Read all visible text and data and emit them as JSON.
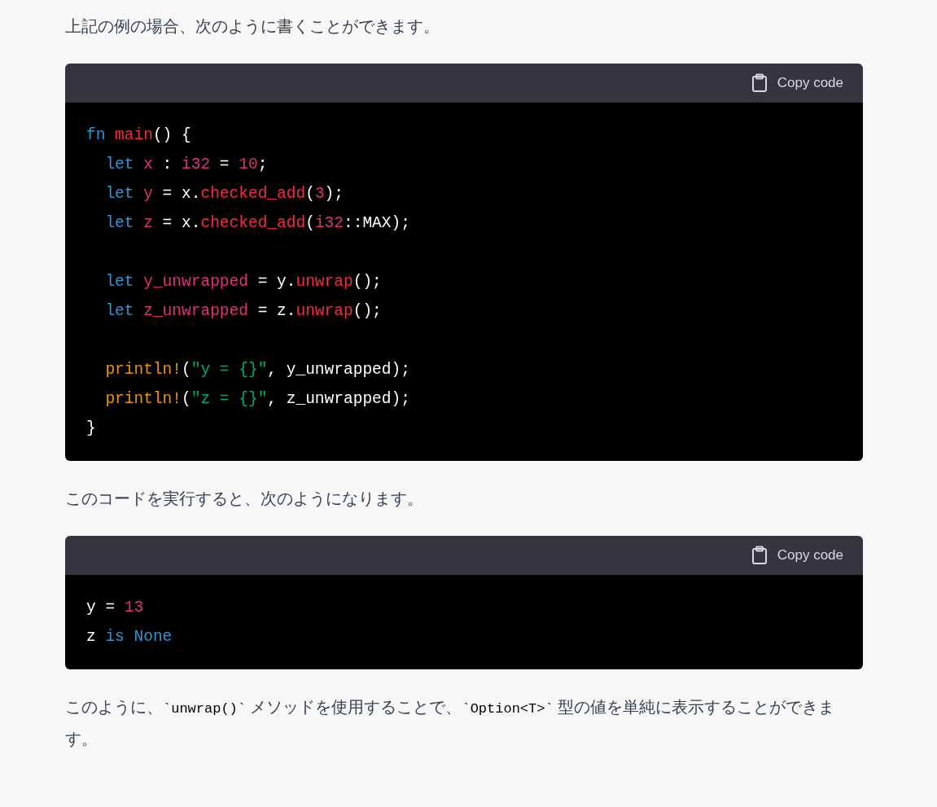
{
  "blocks": [
    {
      "kind": "paragraph",
      "segments": [
        {
          "kind": "text",
          "text": "上記の例の場合、次のように書くことができます。"
        }
      ]
    },
    {
      "kind": "code",
      "copy_label": "Copy code",
      "lines": [
        {
          "kind": "code",
          "tokens": [
            {
              "kind": "keyword",
              "text": "fn "
            },
            {
              "kind": "function",
              "text": "main"
            },
            {
              "kind": "plain",
              "text": "() {"
            }
          ]
        },
        {
          "kind": "code",
          "tokens": [
            {
              "kind": "keyword",
              "text": "  let "
            },
            {
              "kind": "variable",
              "text": "x"
            },
            {
              "kind": "plain",
              "text": " : "
            },
            {
              "kind": "variable",
              "text": "i32"
            },
            {
              "kind": "plain",
              "text": " = "
            },
            {
              "kind": "variable",
              "text": "10"
            },
            {
              "kind": "plain",
              "text": ";"
            }
          ]
        },
        {
          "kind": "code",
          "tokens": [
            {
              "kind": "keyword",
              "text": "  let "
            },
            {
              "kind": "variable",
              "text": "y"
            },
            {
              "kind": "plain",
              "text": " = x."
            },
            {
              "kind": "function",
              "text": "checked_add"
            },
            {
              "kind": "plain",
              "text": "("
            },
            {
              "kind": "variable",
              "text": "3"
            },
            {
              "kind": "plain",
              "text": ");"
            }
          ]
        },
        {
          "kind": "code",
          "tokens": [
            {
              "kind": "keyword",
              "text": "  let "
            },
            {
              "kind": "variable",
              "text": "z"
            },
            {
              "kind": "plain",
              "text": " = x."
            },
            {
              "kind": "function",
              "text": "checked_add"
            },
            {
              "kind": "plain",
              "text": "("
            },
            {
              "kind": "variable",
              "text": "i32"
            },
            {
              "kind": "plain",
              "text": "::MAX);"
            }
          ]
        },
        {
          "kind": "blank"
        },
        {
          "kind": "code",
          "tokens": [
            {
              "kind": "keyword",
              "text": "  let "
            },
            {
              "kind": "variable",
              "text": "y_unwrapped"
            },
            {
              "kind": "plain",
              "text": " = y."
            },
            {
              "kind": "function",
              "text": "unwrap"
            },
            {
              "kind": "plain",
              "text": "();"
            }
          ]
        },
        {
          "kind": "code",
          "tokens": [
            {
              "kind": "keyword",
              "text": "  let "
            },
            {
              "kind": "variable",
              "text": "z_unwrapped"
            },
            {
              "kind": "plain",
              "text": " = z."
            },
            {
              "kind": "function",
              "text": "unwrap"
            },
            {
              "kind": "plain",
              "text": "();"
            }
          ]
        },
        {
          "kind": "blank"
        },
        {
          "kind": "code",
          "tokens": [
            {
              "kind": "macro",
              "text": "  println!"
            },
            {
              "kind": "plain",
              "text": "("
            },
            {
              "kind": "string",
              "text": "\"y = {}\""
            },
            {
              "kind": "plain",
              "text": ", y_unwrapped);"
            }
          ]
        },
        {
          "kind": "code",
          "tokens": [
            {
              "kind": "macro",
              "text": "  println!"
            },
            {
              "kind": "plain",
              "text": "("
            },
            {
              "kind": "string",
              "text": "\"z = {}\""
            },
            {
              "kind": "plain",
              "text": ", z_unwrapped);"
            }
          ]
        },
        {
          "kind": "code",
          "tokens": [
            {
              "kind": "plain",
              "text": "}"
            }
          ]
        }
      ]
    },
    {
      "kind": "paragraph",
      "segments": [
        {
          "kind": "text",
          "text": "このコードを実行すると、次のようになります。"
        }
      ]
    },
    {
      "kind": "code",
      "copy_label": "Copy code",
      "lines": [
        {
          "kind": "code",
          "tokens": [
            {
              "kind": "plain",
              "text": "y = "
            },
            {
              "kind": "variable",
              "text": "13"
            }
          ]
        },
        {
          "kind": "code",
          "tokens": [
            {
              "kind": "plain",
              "text": "z "
            },
            {
              "kind": "keyword",
              "text": "is None"
            }
          ]
        }
      ]
    },
    {
      "kind": "paragraph",
      "segments": [
        {
          "kind": "text",
          "text": "このように、"
        },
        {
          "kind": "code",
          "text": "`unwrap()`"
        },
        {
          "kind": "text",
          "text": " メソッドを使用することで、"
        },
        {
          "kind": "code",
          "text": "`Option<T>`"
        },
        {
          "kind": "text",
          "text": " 型の値を単純に表示することができます。"
        }
      ]
    }
  ]
}
